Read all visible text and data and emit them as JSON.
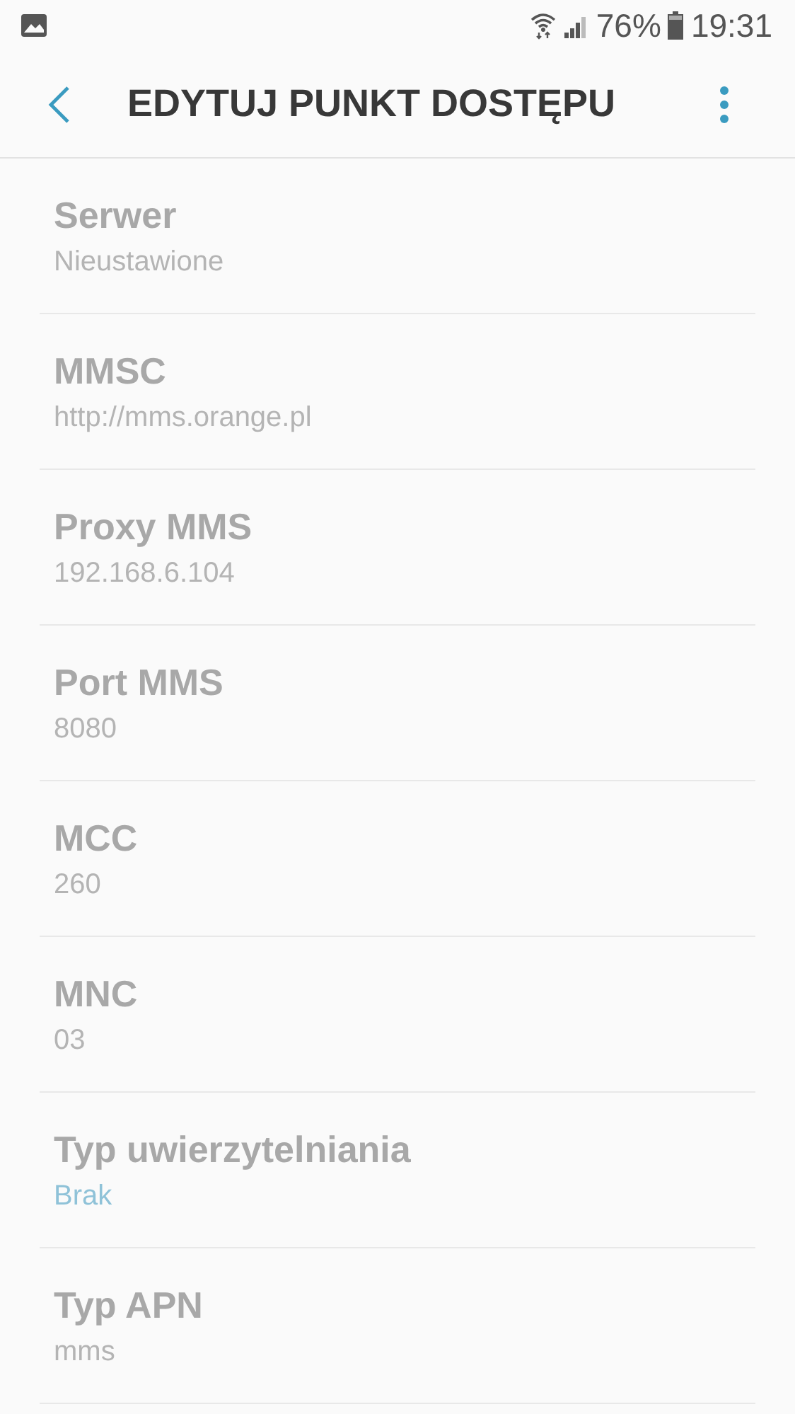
{
  "status_bar": {
    "battery": "76%",
    "time": "19:31"
  },
  "toolbar": {
    "title": "EDYTUJ PUNKT DOSTĘPU"
  },
  "settings": [
    {
      "label": "Serwer",
      "value": "Nieustawione",
      "kind": "text",
      "disabled": true
    },
    {
      "label": "MMSC",
      "value": "http://mms.orange.pl",
      "kind": "text",
      "disabled": true
    },
    {
      "label": "Proxy MMS",
      "value": "192.168.6.104",
      "kind": "text",
      "disabled": true
    },
    {
      "label": "Port MMS",
      "value": "8080",
      "kind": "text",
      "disabled": true
    },
    {
      "label": "MCC",
      "value": "260",
      "kind": "text",
      "disabled": true
    },
    {
      "label": "MNC",
      "value": "03",
      "kind": "text",
      "disabled": true
    },
    {
      "label": "Typ uwierzytelniania",
      "value": "Brak",
      "kind": "choice",
      "disabled": true
    },
    {
      "label": "Typ APN",
      "value": "mms",
      "kind": "text",
      "disabled": true
    }
  ]
}
